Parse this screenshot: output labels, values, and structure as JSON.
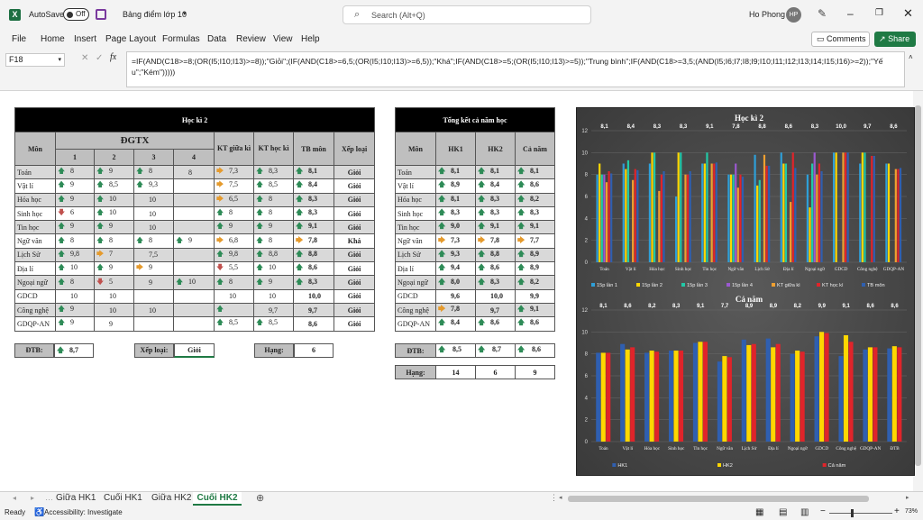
{
  "app": {
    "autosave_label": "AutoSave",
    "autosave_state": "Off",
    "file_name": "Bảng điểm lớp 10",
    "search_placeholder": "Search (Alt+Q)",
    "user_name": "Ho Phong",
    "user_initials": "HP",
    "comments_label": "Comments",
    "share_label": "Share"
  },
  "menu": [
    "File",
    "Home",
    "Insert",
    "Page Layout",
    "Formulas",
    "Data",
    "Review",
    "View",
    "Help"
  ],
  "formula": {
    "cell_ref": "F18",
    "text": "=IF(AND(C18>=8;(OR(I5;I10;I13)>=8));\"Giỏi\";(IF(AND(C18>=6,5;(OR(I5;I10;I13)>=6,5));\"Khá\";IF(AND(C18>=5;(OR(I5;I10;I13)>=5));\"Trung bình\";IF(AND(C18>=3,5;(AND(I5;I6;I7;I8;I9;I10;I11;I12;I13;I14;I15;I16)>=2));\"Yếu\";\"Kém\")))))"
  },
  "hk2": {
    "title": "Học kì 2",
    "h_mon": "Môn",
    "h_dgtx": "ĐGTX",
    "h_cols": [
      "1",
      "2",
      "3",
      "4"
    ],
    "h_ktgk": "KT giữa kì",
    "h_kthk": "KT học kì",
    "h_tb": "TB môn",
    "h_xl": "Xếp loại",
    "rows": [
      {
        "mon": "Toán",
        "c1": "8",
        "c1i": "up",
        "c2": "9",
        "c2i": "up",
        "c3": "8",
        "c3i": "up",
        "c4": "8",
        "c4i": "",
        "gk": "7,3",
        "gki": "sd",
        "hk": "8,3",
        "hki": "up",
        "tb": "8,1",
        "tbi": "up",
        "xl": "Giỏi",
        "g": 1
      },
      {
        "mon": "Vật lí",
        "c1": "9",
        "c1i": "up",
        "c2": "8,5",
        "c2i": "up",
        "c3": "9,3",
        "c3i": "up",
        "c4": "",
        "c4i": "",
        "gk": "7,5",
        "gki": "sd",
        "hk": "8,5",
        "hki": "up",
        "tb": "8,4",
        "tbi": "up",
        "xl": "Giỏi",
        "g": 0
      },
      {
        "mon": "Hóa học",
        "c1": "9",
        "c1i": "up",
        "c2": "10",
        "c2i": "up",
        "c3": "10",
        "c3i": "",
        "c4": "",
        "c4i": "",
        "gk": "6,5",
        "gki": "sd",
        "hk": "8",
        "hki": "up",
        "tb": "8,3",
        "tbi": "up",
        "xl": "Giỏi",
        "g": 1
      },
      {
        "mon": "Sinh học",
        "c1": "6",
        "c1i": "dn",
        "c2": "10",
        "c2i": "up",
        "c3": "10",
        "c3i": "",
        "c4": "",
        "c4i": "",
        "gk": "8",
        "gki": "up",
        "hk": "8",
        "hki": "up",
        "tb": "8,3",
        "tbi": "up",
        "xl": "Giỏi",
        "g": 0
      },
      {
        "mon": "Tin học",
        "c1": "9",
        "c1i": "up",
        "c2": "9",
        "c2i": "up",
        "c3": "10",
        "c3i": "",
        "c4": "",
        "c4i": "",
        "gk": "9",
        "gki": "up",
        "hk": "9",
        "hki": "up",
        "tb": "9,1",
        "tbi": "up",
        "xl": "Giỏi",
        "g": 1
      },
      {
        "mon": "Ngữ văn",
        "c1": "8",
        "c1i": "up",
        "c2": "8",
        "c2i": "up",
        "c3": "8",
        "c3i": "up",
        "c4": "9",
        "c4i": "up",
        "gk": "6,8",
        "gki": "sd",
        "hk": "8",
        "hki": "up",
        "tb": "7,8",
        "tbi": "sd",
        "xl": "Khá",
        "g": 0
      },
      {
        "mon": "Lịch Sử",
        "c1": "9,8",
        "c1i": "up",
        "c2": "7",
        "c2i": "sd",
        "c3": "7,5",
        "c3i": "",
        "c4": "",
        "c4i": "",
        "gk": "9,8",
        "gki": "up",
        "hk": "8,8",
        "hki": "up",
        "tb": "8,8",
        "tbi": "up",
        "xl": "Giỏi",
        "g": 1
      },
      {
        "mon": "Địa lí",
        "c1": "10",
        "c1i": "up",
        "c2": "9",
        "c2i": "up",
        "c3": "9",
        "c3i": "sd",
        "c4": "",
        "c4i": "",
        "gk": "5,5",
        "gki": "dn",
        "hk": "10",
        "hki": "up",
        "tb": "8,6",
        "tbi": "up",
        "xl": "Giỏi",
        "g": 0
      },
      {
        "mon": "Ngoại ngữ",
        "c1": "8",
        "c1i": "up",
        "c2": "5",
        "c2i": "dn",
        "c3": "9",
        "c3i": "",
        "c4": "10",
        "c4i": "up",
        "gk": "8",
        "gki": "up",
        "hk": "9",
        "hki": "up",
        "tb": "8,3",
        "tbi": "up",
        "xl": "Giỏi",
        "g": 1
      },
      {
        "mon": "GDCD",
        "c1": "10",
        "c1i": "",
        "c2": "10",
        "c2i": "",
        "c3": "",
        "c3i": "",
        "c4": "",
        "c4i": "",
        "gk": "10",
        "gki": "",
        "hk": "10",
        "hki": "",
        "tb": "10,0",
        "tbi": "",
        "xl": "Giỏi",
        "g": 0
      },
      {
        "mon": "Công nghệ",
        "c1": "9",
        "c1i": "up",
        "c2": "10",
        "c2i": "",
        "c3": "10",
        "c3i": "",
        "c4": "",
        "c4i": "",
        "gk": "",
        "gki": "up",
        "hk": "9,7",
        "hki": "",
        "tb": "9,7",
        "tbi": "",
        "xl": "Giỏi",
        "g": 1
      },
      {
        "mon": "GDQP-AN",
        "c1": "9",
        "c1i": "up",
        "c2": "9",
        "c2i": "",
        "c3": "",
        "c3i": "",
        "c4": "",
        "c4i": "",
        "gk": "8,5",
        "gki": "up",
        "hk": "8,5",
        "hki": "up",
        "tb": "8,6",
        "tbi": "",
        "xl": "Giỏi",
        "g": 0
      }
    ],
    "dtb_label": "ĐTB:",
    "dtb": "8,7",
    "xeploai_label": "Xếp loại:",
    "xeploai": "Giỏi",
    "hang_label": "Hạng:",
    "hang": "6"
  },
  "year": {
    "title": "Tổng kết cả năm học",
    "h_mon": "Môn",
    "h_hk1": "HK1",
    "h_hk2": "HK2",
    "h_cn": "Cả năm",
    "rows": [
      {
        "mon": "Toán",
        "hk1": "8,1",
        "i1": "up",
        "hk2": "8,1",
        "i2": "up",
        "cn": "8,1",
        "i3": "up",
        "g": 1
      },
      {
        "mon": "Vật lí",
        "hk1": "8,9",
        "i1": "up",
        "hk2": "8,4",
        "i2": "up",
        "cn": "8,6",
        "i3": "up",
        "g": 0
      },
      {
        "mon": "Hóa học",
        "hk1": "8,1",
        "i1": "up",
        "hk2": "8,3",
        "i2": "up",
        "cn": "8,2",
        "i3": "up",
        "g": 1
      },
      {
        "mon": "Sinh học",
        "hk1": "8,3",
        "i1": "up",
        "hk2": "8,3",
        "i2": "up",
        "cn": "8,3",
        "i3": "up",
        "g": 0
      },
      {
        "mon": "Tin học",
        "hk1": "9,0",
        "i1": "up",
        "hk2": "9,1",
        "i2": "up",
        "cn": "9,1",
        "i3": "up",
        "g": 1
      },
      {
        "mon": "Ngữ văn",
        "hk1": "7,3",
        "i1": "sd",
        "hk2": "7,8",
        "i2": "sd",
        "cn": "7,7",
        "i3": "sd",
        "g": 0
      },
      {
        "mon": "Lịch Sử",
        "hk1": "9,3",
        "i1": "up",
        "hk2": "8,8",
        "i2": "up",
        "cn": "8,9",
        "i3": "up",
        "g": 1
      },
      {
        "mon": "Địa lí",
        "hk1": "9,4",
        "i1": "up",
        "hk2": "8,6",
        "i2": "up",
        "cn": "8,9",
        "i3": "up",
        "g": 0
      },
      {
        "mon": "Ngoại ngữ",
        "hk1": "8,0",
        "i1": "up",
        "hk2": "8,3",
        "i2": "up",
        "cn": "8,2",
        "i3": "up",
        "g": 1
      },
      {
        "mon": "GDCD",
        "hk1": "9,6",
        "i1": "",
        "hk2": "10,0",
        "i2": "",
        "cn": "9,9",
        "i3": "",
        "g": 0
      },
      {
        "mon": "Công nghệ",
        "hk1": "7,8",
        "i1": "sd",
        "hk2": "9,7",
        "i2": "",
        "cn": "9,1",
        "i3": "up",
        "g": 1
      },
      {
        "mon": "GDQP-AN",
        "hk1": "8,4",
        "i1": "up",
        "hk2": "8,6",
        "i2": "up",
        "cn": "8,6",
        "i3": "up",
        "g": 0
      }
    ],
    "dtb_label": "ĐTB:",
    "dtb_hk1": "8,5",
    "dtb_hk2": "8,7",
    "dtb_cn": "8,6",
    "hang_label": "Hạng:",
    "hang_hk1": "14",
    "hang_hk2": "6",
    "hang_cn": "9"
  },
  "chart_data": [
    {
      "type": "bar",
      "title": "Học kì 2",
      "categories": [
        "Toán",
        "Vật lí",
        "Hóa học",
        "Sinh học",
        "Tin học",
        "Ngữ văn",
        "Lịch Sử",
        "Địa lí",
        "Ngoại ngữ",
        "GDCD",
        "Công nghệ",
        "GDQP-AN"
      ],
      "ylim": [
        0,
        12
      ],
      "yticks": [
        0,
        2,
        4,
        6,
        8,
        10,
        12
      ],
      "grid": true,
      "legend": "bottom",
      "series": [
        {
          "name": "15p lần 1",
          "color": "#2e9fd8",
          "values": [
            8,
            9,
            9,
            6,
            9,
            8,
            9.8,
            10,
            8,
            10,
            9,
            9
          ]
        },
        {
          "name": "15p lần 2",
          "color": "#ffd700",
          "values": [
            9,
            8.5,
            10,
            10,
            9,
            8,
            7,
            9,
            5,
            10,
            10,
            9
          ]
        },
        {
          "name": "15p lần 3",
          "color": "#21c9a6",
          "values": [
            8,
            9.3,
            10,
            10,
            10,
            8,
            7.5,
            9,
            9,
            null,
            10,
            null
          ]
        },
        {
          "name": "15p lần 4",
          "color": "#9b59d0",
          "values": [
            8,
            null,
            null,
            null,
            null,
            9,
            null,
            null,
            10,
            null,
            null,
            null
          ]
        },
        {
          "name": "KT giữa kì",
          "color": "#f0a030",
          "values": [
            7.3,
            7.5,
            6.5,
            8,
            9,
            6.8,
            9.8,
            5.5,
            8,
            10,
            null,
            8.5
          ]
        },
        {
          "name": "KT học kì",
          "color": "#e0242a",
          "values": [
            8.3,
            8.5,
            8,
            8,
            9,
            8,
            8.8,
            10,
            9,
            10,
            9.7,
            8.5
          ]
        },
        {
          "name": "TB môn",
          "color": "#2f5fb0",
          "values": [
            8.1,
            8.4,
            8.3,
            8.3,
            9.1,
            7.8,
            8.8,
            8.6,
            8.3,
            10,
            9.7,
            8.6
          ]
        }
      ],
      "labels": [
        "8,1",
        "8,4",
        "8,3",
        "8,3",
        "9,1",
        "7,8",
        "8,8",
        "8,6",
        "8,3",
        "10,0",
        "9,7",
        "8,6"
      ]
    },
    {
      "type": "bar",
      "title": "Cả năm",
      "categories": [
        "Toán",
        "Vật lí",
        "Hóa học",
        "Sinh học",
        "Tin học",
        "Ngữ văn",
        "Lịch Sử",
        "Địa lí",
        "Ngoại ngữ",
        "GDCD",
        "Công nghệ",
        "GDQP-AN",
        "ĐTB"
      ],
      "ylim": [
        0,
        12
      ],
      "yticks": [
        0,
        2,
        4,
        6,
        8,
        10,
        12
      ],
      "grid": true,
      "legend": "bottom",
      "series": [
        {
          "name": "HK1",
          "color": "#2f5fb0",
          "values": [
            8.1,
            8.9,
            8.1,
            8.3,
            9.0,
            7.3,
            9.3,
            9.4,
            8.0,
            9.6,
            7.8,
            8.4,
            8.5
          ]
        },
        {
          "name": "HK2",
          "color": "#ffd700",
          "values": [
            8.1,
            8.4,
            8.3,
            8.3,
            9.1,
            7.8,
            8.8,
            8.6,
            8.3,
            10.0,
            9.7,
            8.6,
            8.7
          ]
        },
        {
          "name": "Cả năm",
          "color": "#e0242a",
          "values": [
            8.1,
            8.6,
            8.2,
            8.3,
            9.1,
            7.7,
            8.9,
            8.9,
            8.2,
            9.9,
            9.1,
            8.6,
            8.6
          ]
        }
      ],
      "labels": [
        "8,1",
        "8,6",
        "8,2",
        "8,3",
        "9,1",
        "7,7",
        "8,9",
        "8,9",
        "8,2",
        "9,9",
        "9,1",
        "8,6",
        "8,6"
      ]
    }
  ],
  "tabs": [
    "Giữa HK1",
    "Cuối HK1",
    "Giữa HK2",
    "Cuối HK2"
  ],
  "active_tab": "Cuối HK2",
  "status": {
    "ready": "Ready",
    "accessibility": "Accessibility: Investigate",
    "zoom": "73%"
  }
}
